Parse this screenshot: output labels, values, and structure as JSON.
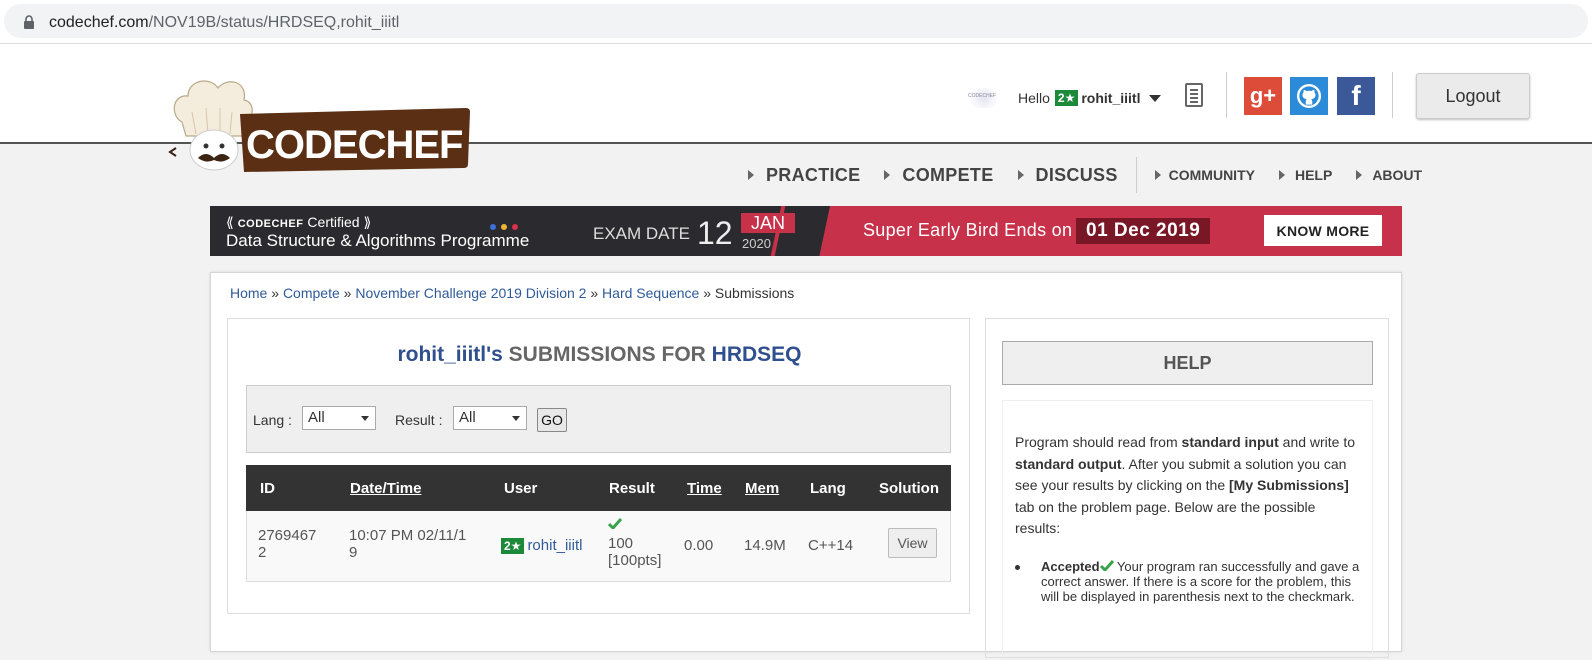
{
  "browser": {
    "url_domain": "codechef.com",
    "url_path": "/NOV19B/status/HRDSEQ,rohit_iiitl"
  },
  "header": {
    "logo_text": "CODECHEF",
    "hello": "Hello",
    "star": "2★",
    "username": "rohit_iiitl",
    "logout": "Logout",
    "social": {
      "gplus": "g+",
      "fb": "f"
    }
  },
  "nav": {
    "practice": "PRACTICE",
    "compete": "COMPETE",
    "discuss": "DISCUSS",
    "community": "COMMUNITY",
    "help": "HELP",
    "about": "ABOUT"
  },
  "banner": {
    "brand": "CODECHEF",
    "certified": "Certified",
    "program": "Data Structure & Algorithms Programme",
    "exam_date_label": "EXAM DATE",
    "day": "12",
    "month": "JAN",
    "year": "2020",
    "early_bird": "Super Early Bird Ends on",
    "early_bird_date": "01 Dec 2019",
    "cta": "KNOW MORE"
  },
  "breadcrumb": {
    "home": "Home",
    "compete": "Compete",
    "contest": "November Challenge 2019 Division 2",
    "problem": "Hard Sequence",
    "current": "Submissions",
    "sep": "»"
  },
  "submissions": {
    "title_user": "rohit_iiitl's",
    "title_mid": "SUBMISSIONS FOR",
    "title_problem": "HRDSEQ",
    "lang_label": "Lang :",
    "lang_value": "All",
    "result_label": "Result :",
    "result_value": "All",
    "go": "GO",
    "columns": {
      "id": "ID",
      "datetime": "Date/Time",
      "user": "User",
      "result": "Result",
      "time": "Time",
      "mem": "Mem",
      "lang": "Lang",
      "solution": "Solution"
    },
    "row": {
      "id_line1": "2769467",
      "id_line2": "2",
      "date_line1": "10:07 PM 02/11/1",
      "date_line2": "9",
      "star": "2★",
      "user": "rohit_iiitl",
      "result_line1": "100",
      "result_line2": "[100pts]",
      "time": "0.00",
      "mem": "14.9M",
      "lang": "C++14",
      "view": "View"
    }
  },
  "help": {
    "heading": "HELP",
    "p1a": "Program should read from ",
    "p1b": "standard input",
    "p1c": " and write to ",
    "p1d": "standard output",
    "p1e": ". After you submit a solution you can see your results by clicking on the ",
    "p1f": "[My Submissions]",
    "p1g": " tab on the problem page. Below are the possible results:",
    "accepted": "Accepted",
    "accepted_desc": " Your program ran successfully and gave a correct answer. If there is a score for the problem, this will be displayed in parenthesis next to the checkmark."
  },
  "colors": {
    "accent_blue": "#2f4f8f",
    "banner_red": "#c8314a",
    "star_green": "#1d8a3a",
    "check_green": "#3aa34a"
  }
}
